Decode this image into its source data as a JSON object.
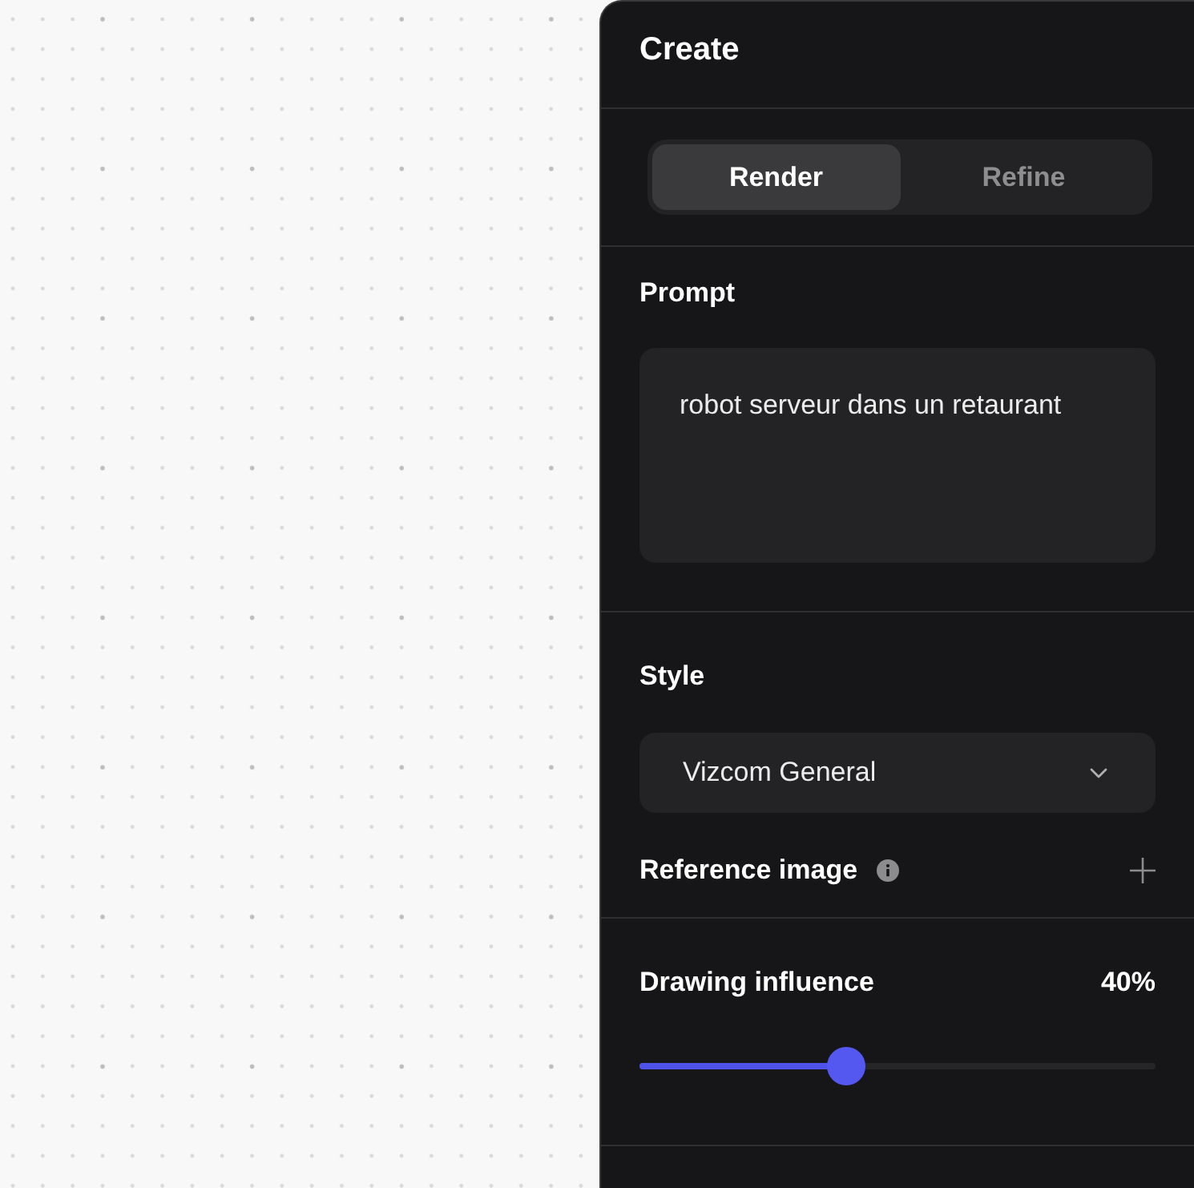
{
  "panel": {
    "title": "Create"
  },
  "tabs": [
    {
      "label": "Render",
      "selected": true
    },
    {
      "label": "Refine",
      "selected": false
    }
  ],
  "prompt": {
    "label": "Prompt",
    "value": "robot serveur dans un retaurant"
  },
  "style": {
    "label": "Style",
    "value": "Vizcom General"
  },
  "reference_image": {
    "label": "Reference image"
  },
  "drawing_influence": {
    "label": "Drawing influence",
    "reading": "40%",
    "level": 0.4
  }
}
